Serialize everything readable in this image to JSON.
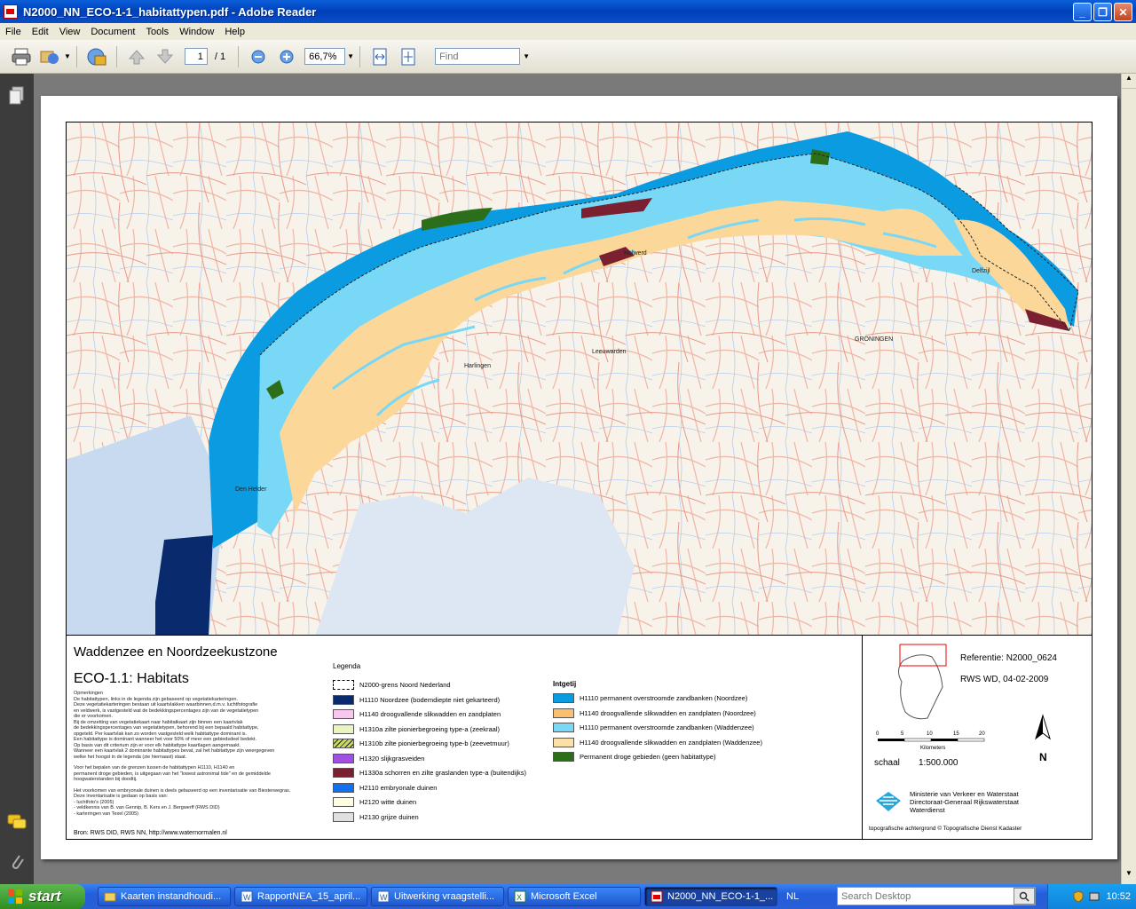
{
  "window": {
    "title": "N2000_NN_ECO-1-1_habitattypen.pdf - Adobe Reader"
  },
  "menu": [
    "File",
    "Edit",
    "View",
    "Document",
    "Tools",
    "Window",
    "Help"
  ],
  "toolbar": {
    "page_current": "1",
    "page_total": "/ 1",
    "zoom": "66,7%",
    "find_placeholder": "Find"
  },
  "map": {
    "places": [
      "Holwerd",
      "Delfzijl",
      "GRONINGEN",
      "Leeuwarden",
      "Harlingen",
      "Den Helder"
    ],
    "colors": {
      "sea_north": "#0a9be0",
      "sea_deep": "#0a2a6e",
      "flats": "#fbd89a",
      "tidal": "#78d8f5",
      "land": "#f8f3ea",
      "dry": "#2c6e1a",
      "saltmarsh": "#7a2030"
    }
  },
  "legend": {
    "title": "Waddenzee en Noordzeekustzone",
    "subtitle": "ECO-1.1: Habitats",
    "notes": [
      "Opmerkingen",
      "De habitattypen, links in de legenda zijn gebaseerd op vegetatiekarteringen.",
      "Deze vegetatiekarteringen bestaan uit kaartvlakken waarbinnen,d.m.v. luchtfotografie",
      " en veldwerk, is vastgesteld wat de bedekkingspercentages zijn van de vegetatietypen",
      "die er voorkomen.",
      "Bij de omzetting van vegetatiekaart naar habitatkaart zijn binnen een kaartvlak",
      "de bedekkingspercentages van vegetatietypen, behorend bij een bepaald habitattype,",
      " opgeteld. Per kaartvlak kan zo worden vastgesteld welk habitattype dominant is.",
      "Een habitattype is dominant wanneer het voor 50% of meer een gebiedsdeel bedekt.",
      "Op basis van dit criterium zijn er voor elk habitattype kaartlagen aangemaakt.",
      "Wanneer een kaartvlak 2 dominante habitattypes  bevat, zal het habitattype zijn weergegeven",
      "welke het hoogst in de legenda (zie hiernaast) staat.",
      "",
      "Voor het bepalen van de grenzen tussen de habitattypen H1110, H1140 en",
      "permanent droge gebieden, is uitgegaan van het \"lowest astronimal tide\" en de gemiddelde",
      "hoogwaterstanden bij doodtij.",
      "",
      "Het voorkomen van embryonale duinen is deels gebaseerd op een inventarisatie van Biesterwegras.",
      "Deze inventarisatie is gedaan op basis van:",
      "- luchtfoto's (2005)",
      "- veldkennis van B. van Gennip, B. Kers en J. Bergwerff (RWS DID)",
      "- karteringen van Texel (2005)"
    ],
    "source": "Bron: RWS DID, RWS NN, http://www.waternormalen.nl",
    "legenda_head": "Legenda",
    "intgetij_head": "Intgetij",
    "left_items": [
      {
        "label": "N2000-grens Noord Nederland",
        "color": "#ffffff",
        "style": "dashed"
      },
      {
        "label": "H1110 Noordzee (bodemdiepte niet gekarteerd)",
        "color": "#0a2a6e"
      },
      {
        "label": "H1140 droogvallende slikwadden en zandplaten",
        "color": "#f7c8ee"
      },
      {
        "label": "H1310a zilte pionierbegroeing type-a (zeekraal)",
        "color": "#e8f5c0"
      },
      {
        "label": "H1310b zilte pionierbegroeing type-b (zeevetmuur)",
        "color": "#c8d860",
        "style": "hatch"
      },
      {
        "label": "H1320 slijkgrasveiden",
        "color": "#a050e0"
      },
      {
        "label": "H1330a schorren en zilte graslanden type-a (buitendijks)",
        "color": "#7a2030"
      },
      {
        "label": "H2110 embryonale duinen",
        "color": "#1070f0"
      },
      {
        "label": "H2120 witte duinen",
        "color": "#fffde0"
      },
      {
        "label": "H2130 grijze duinen",
        "color": "#e0e0e0"
      }
    ],
    "right_items": [
      {
        "label": "H1110 permanent overstroomde zandbanken (Noordzee)",
        "color": "#0a9be0"
      },
      {
        "label": "H1140 droogvallende slikwadden en zandplaten (Noordzee)",
        "color": "#f8c070"
      },
      {
        "label": "H1110 permanent overstroomde zandbanken (Waddenzee)",
        "color": "#78d8f5"
      },
      {
        "label": "H1140 droogvallende slikwadden en zandplaten (Waddenzee)",
        "color": "#fbe0a8"
      },
      {
        "label": "Permanent droge gebieden (geen habitattype)",
        "color": "#2c6e1a"
      }
    ],
    "reference": "Referentie: N2000_0624",
    "rws_date": "RWS WD, 04-02-2009",
    "scale_ticks": [
      "0",
      "5",
      "10",
      "15",
      "20"
    ],
    "scale_unit": "Kilometers",
    "scale_label": "schaal",
    "scale_value": "1:500.000",
    "north": "N",
    "ministry": [
      "Ministerie van Verkeer en Waterstaat",
      "Directoraat-Generaal Rijkswaterstaat",
      "Waterdienst"
    ],
    "background_credit": "topografische achtergrond © Topografische Dienst Kadaster"
  },
  "taskbar": {
    "start": "start",
    "tasks": [
      "Kaarten instandhoudi...",
      "RapportNEA_15_april...",
      "Uitwerking vraagstelli...",
      "Microsoft Excel",
      "N2000_NN_ECO-1-1_..."
    ],
    "lang": "NL",
    "search_placeholder": "Search Desktop",
    "clock": "10:52"
  }
}
